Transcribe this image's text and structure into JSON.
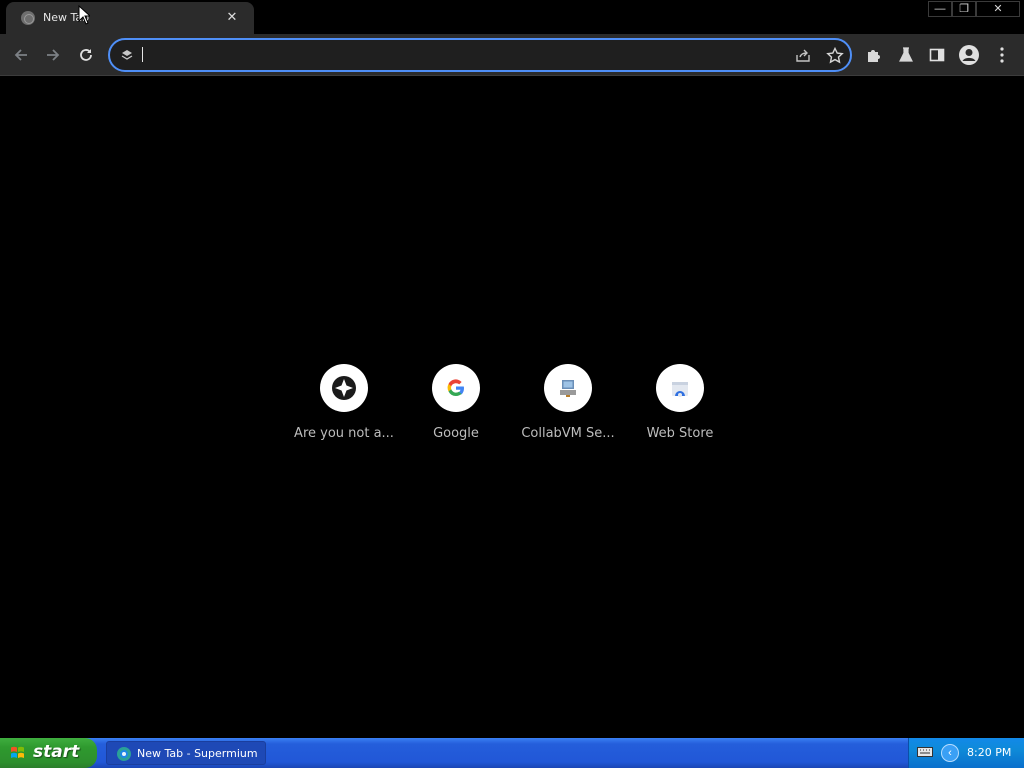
{
  "browser": {
    "tab": {
      "title": "New Tab",
      "close_glyph": "✕",
      "favicon": "globe-icon"
    },
    "window_controls": {
      "minimize": "—",
      "maximize": "❐",
      "close": "✕"
    },
    "toolbar": {
      "back": "back-arrow-icon",
      "forward": "forward-arrow-icon",
      "reload": "reload-icon",
      "omnibox": {
        "value": "",
        "placeholder": ""
      },
      "extensions": "puzzle-icon",
      "labs": "flask-icon",
      "side_panel": "side-panel-icon",
      "profile": "profile-icon",
      "menu": "kebab-menu-icon"
    },
    "accent_color": "#4f8ff7"
  },
  "new_tab_page": {
    "shortcuts": [
      {
        "label": "Are you not a...",
        "icon": "compass-icon"
      },
      {
        "label": "Google",
        "icon": "google-g-icon"
      },
      {
        "label": "CollabVM Se...",
        "icon": "collabvm-icon"
      },
      {
        "label": "Web Store",
        "icon": "web-store-icon"
      }
    ]
  },
  "taskbar": {
    "start_label": "start",
    "task_items": [
      {
        "label": "New Tab - Supermium"
      }
    ],
    "clock": "8:20 PM"
  }
}
